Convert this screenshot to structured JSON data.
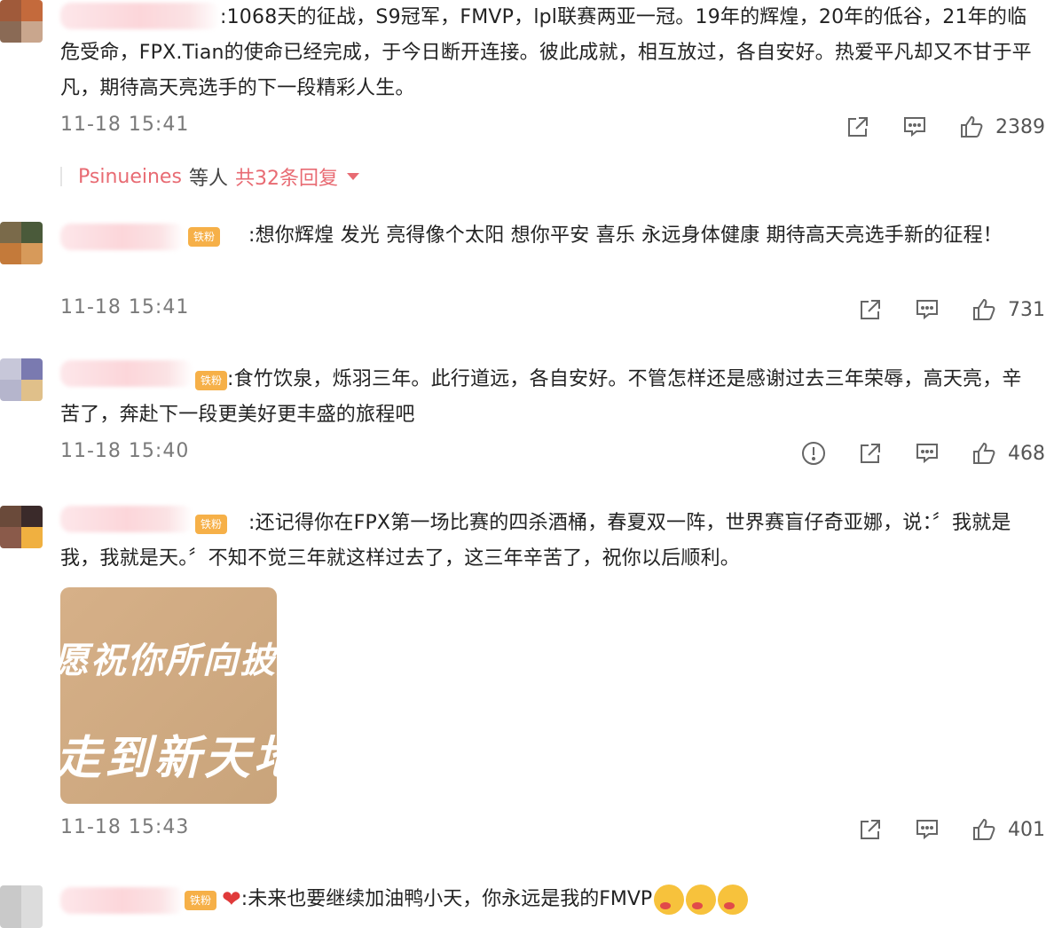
{
  "comments": [
    {
      "text_line": ":1068天的征战，S9冠军，FMVP，lpl联赛两亚一冠。19年的辉煌，20年的低谷，21年的临危受命，FPX.Tian的使命已经完成，于今日断开连接。彼此成就，相互放过，各自安好。热爱平凡却又不甘于平凡，期待高天亮选手的下一段精彩人生。",
      "time": "11-18 15:41",
      "likes": "2389",
      "avatar_colors": [
        "#a05a3a",
        "#c46a3c",
        "#8a6a55",
        "#c9a68d"
      ]
    },
    {
      "text_line": ":想你辉煌 发光 亮得像个太阳 想你平安 喜乐 永远身体健康 期待高天亮选手新的征程！",
      "time": "11-18 15:41",
      "likes": "731",
      "fan_badge": "铁粉",
      "avatar_colors": [
        "#7a6a4a",
        "#4a5a3a",
        "#c47a3a",
        "#d79a5a"
      ]
    },
    {
      "text_line": ":食竹饮泉，烁羽三年。此行道远，各自安好。不管怎样还是感谢过去三年荣辱，高天亮，辛苦了，奔赴下一段更美好更丰盛的旅程吧",
      "time": "11-18 15:40",
      "likes": "468",
      "fan_badge": "铁粉",
      "avatar_colors": [
        "#c7c7d9",
        "#7a7ab0",
        "#b5b5cc",
        "#e0c08a"
      ]
    },
    {
      "text_line": ":还记得你在FPX第一场比赛的四杀酒桶，春夏双一阵，世界赛盲仔奇亚娜，说：〞我就是我，我就是天。〞不知不觉三年就这样过去了，这三年辛苦了，祝你以后顺利。",
      "time": "11-18 15:43",
      "likes": "401",
      "fan_badge": "铁粉",
      "image_text_1": "愿祝你所向披靡",
      "image_text_2": "走到新天地",
      "avatar_colors": [
        "#6a4a3a",
        "#3a2a2a",
        "#8a5a4a",
        "#f0b040"
      ]
    },
    {
      "text_line": ":未来也要继续加油鸭小天，你永远是我的FMVP",
      "fan_badge": "铁粉",
      "heart": "❤",
      "avatar_colors": [
        "#c9c9c9",
        "#dcdcdc",
        "#c9c9c9",
        "#dcdcdc"
      ]
    }
  ],
  "replies": {
    "names": "Psinueines",
    "mid": "等人",
    "count": "共32条回复"
  },
  "icons": {
    "share": "share-icon",
    "comment": "comment-icon",
    "like": "thumbs-up-icon",
    "report": "report-icon"
  }
}
